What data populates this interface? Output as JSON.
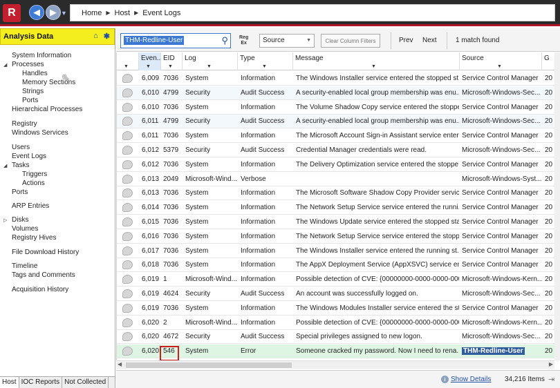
{
  "breadcrumb": [
    "Home",
    "Host",
    "Event Logs"
  ],
  "left_panel": {
    "title": "Analysis Data",
    "tree": [
      {
        "label": "System Information",
        "indent": 0
      },
      {
        "label": "Processes",
        "indent": 0,
        "expanded": true
      },
      {
        "label": "Handles",
        "indent": 1
      },
      {
        "label": "Memory Sections",
        "indent": 1
      },
      {
        "label": "Strings",
        "indent": 1
      },
      {
        "label": "Ports",
        "indent": 1
      },
      {
        "label": "Hierarchical Processes",
        "indent": 0
      },
      {
        "label": "Registry",
        "indent": 0
      },
      {
        "label": "Windows Services",
        "indent": 0
      },
      {
        "label": "Users",
        "indent": 0
      },
      {
        "label": "Event Logs",
        "indent": 0
      },
      {
        "label": "Tasks",
        "indent": 0,
        "expanded": true
      },
      {
        "label": "Triggers",
        "indent": 1
      },
      {
        "label": "Actions",
        "indent": 1
      },
      {
        "label": "Ports",
        "indent": 0
      },
      {
        "label": "ARP Entries",
        "indent": 0
      },
      {
        "label": "Disks",
        "indent": 0,
        "collapsed": true
      },
      {
        "label": "Volumes",
        "indent": 0
      },
      {
        "label": "Registry Hives",
        "indent": 0
      },
      {
        "label": "File Download History",
        "indent": 0
      },
      {
        "label": "Timeline",
        "indent": 0
      },
      {
        "label": "Tags and Comments",
        "indent": 0
      },
      {
        "label": "Acquisition History",
        "indent": 0
      }
    ],
    "tabs": [
      "Host",
      "IOC Reports",
      "Not Collected"
    ]
  },
  "toolbar": {
    "search_value": "THM-Redline-User",
    "regex_label_1": "Reg",
    "regex_label_2": "Ex",
    "select_value": "Source",
    "clear_label": "Clear Column Filters",
    "prev_label": "Prev",
    "next_label": "Next",
    "match_text": "1 match found"
  },
  "grid": {
    "columns": [
      "",
      "Even...",
      "EID",
      "Log",
      "Type",
      "Message",
      "Source",
      "G"
    ],
    "rows": [
      [
        "6,009",
        "7036",
        "System",
        "Information",
        "The Windows Installer service entered the stopped st...",
        "Service Control Manager",
        "20"
      ],
      [
        "6,010",
        "4799",
        "Security",
        "Audit Success",
        "A security-enabled local group membership was enu...",
        "Microsoft-Windows-Sec...",
        "20"
      ],
      [
        "6,010",
        "7036",
        "System",
        "Information",
        "The Volume Shadow Copy service entered the stoppe...",
        "Service Control Manager",
        "20"
      ],
      [
        "6,011",
        "4799",
        "Security",
        "Audit Success",
        "A security-enabled local group membership was enu...",
        "Microsoft-Windows-Sec...",
        "20"
      ],
      [
        "6,011",
        "7036",
        "System",
        "Information",
        "The Microsoft Account Sign-in Assistant service enter...",
        "Service Control Manager",
        "20"
      ],
      [
        "6,012",
        "5379",
        "Security",
        "Audit Success",
        "Credential Manager credentials were read.",
        "Microsoft-Windows-Sec...",
        "20"
      ],
      [
        "6,012",
        "7036",
        "System",
        "Information",
        "The Delivery Optimization service entered the stoppe...",
        "Service Control Manager",
        "20"
      ],
      [
        "6,013",
        "2049",
        "Microsoft-Wind...",
        "Verbose",
        "",
        "Microsoft-Windows-Syst...",
        "20"
      ],
      [
        "6,013",
        "7036",
        "System",
        "Information",
        "The Microsoft Software Shadow Copy Provider servic...",
        "Service Control Manager",
        "20"
      ],
      [
        "6,014",
        "7036",
        "System",
        "Information",
        "The Network Setup Service service entered the runni...",
        "Service Control Manager",
        "20"
      ],
      [
        "6,015",
        "7036",
        "System",
        "Information",
        "The Windows Update service entered the stopped sta...",
        "Service Control Manager",
        "20"
      ],
      [
        "6,016",
        "7036",
        "System",
        "Information",
        "The Network Setup Service service entered the stopp...",
        "Service Control Manager",
        "20"
      ],
      [
        "6,017",
        "7036",
        "System",
        "Information",
        "The Windows Installer service entered the running st...",
        "Service Control Manager",
        "20"
      ],
      [
        "6,018",
        "7036",
        "System",
        "Information",
        "The AppX Deployment Service (AppXSVC) service ent...",
        "Service Control Manager",
        "20"
      ],
      [
        "6,019",
        "1",
        "Microsoft-Wind...",
        "Information",
        "Possible detection of CVE: {00000000-0000-0000-000...",
        "Microsoft-Windows-Kern...",
        "20"
      ],
      [
        "6,019",
        "4624",
        "Security",
        "Audit Success",
        "An account was successfully logged on.",
        "Microsoft-Windows-Sec...",
        "20"
      ],
      [
        "6,019",
        "7036",
        "System",
        "Information",
        "The Windows Modules Installer service entered the st...",
        "Service Control Manager",
        "20"
      ],
      [
        "6,020",
        "2",
        "Microsoft-Wind...",
        "Information",
        "Possible detection of CVE: {00000000-0000-0000-000...",
        "Microsoft-Windows-Kern...",
        "20"
      ],
      [
        "6,020",
        "4672",
        "Security",
        "Audit Success",
        "Special privileges assigned to new logon.",
        "Microsoft-Windows-Sec...",
        "20"
      ],
      [
        "6,020",
        "546",
        "System",
        "Error",
        "Someone cracked my password. Now I need to rena...",
        "THM-Redline-User",
        "20"
      ]
    ]
  },
  "status": {
    "show_details": "Show Details",
    "item_count": "34,216 Items"
  }
}
